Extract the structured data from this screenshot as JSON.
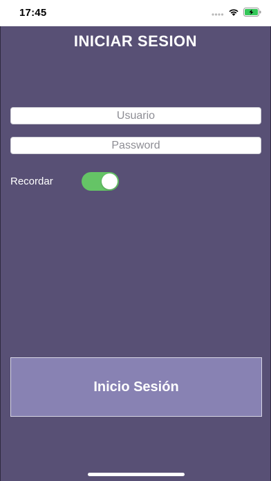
{
  "status_bar": {
    "time": "17:45",
    "icons": [
      "signal-dots-icon",
      "wifi-icon",
      "battery-charging-icon"
    ],
    "battery_color": "#34c759"
  },
  "screen": {
    "background": "#585075",
    "title": "INICIAR SESION",
    "username": {
      "placeholder": "Usuario",
      "value": ""
    },
    "password": {
      "placeholder": "Password",
      "value": ""
    },
    "remember": {
      "label": "Recordar",
      "on": true,
      "color": "#65c466"
    },
    "login_button": {
      "label": "Inicio Sesión",
      "color": "#8882b3"
    }
  }
}
